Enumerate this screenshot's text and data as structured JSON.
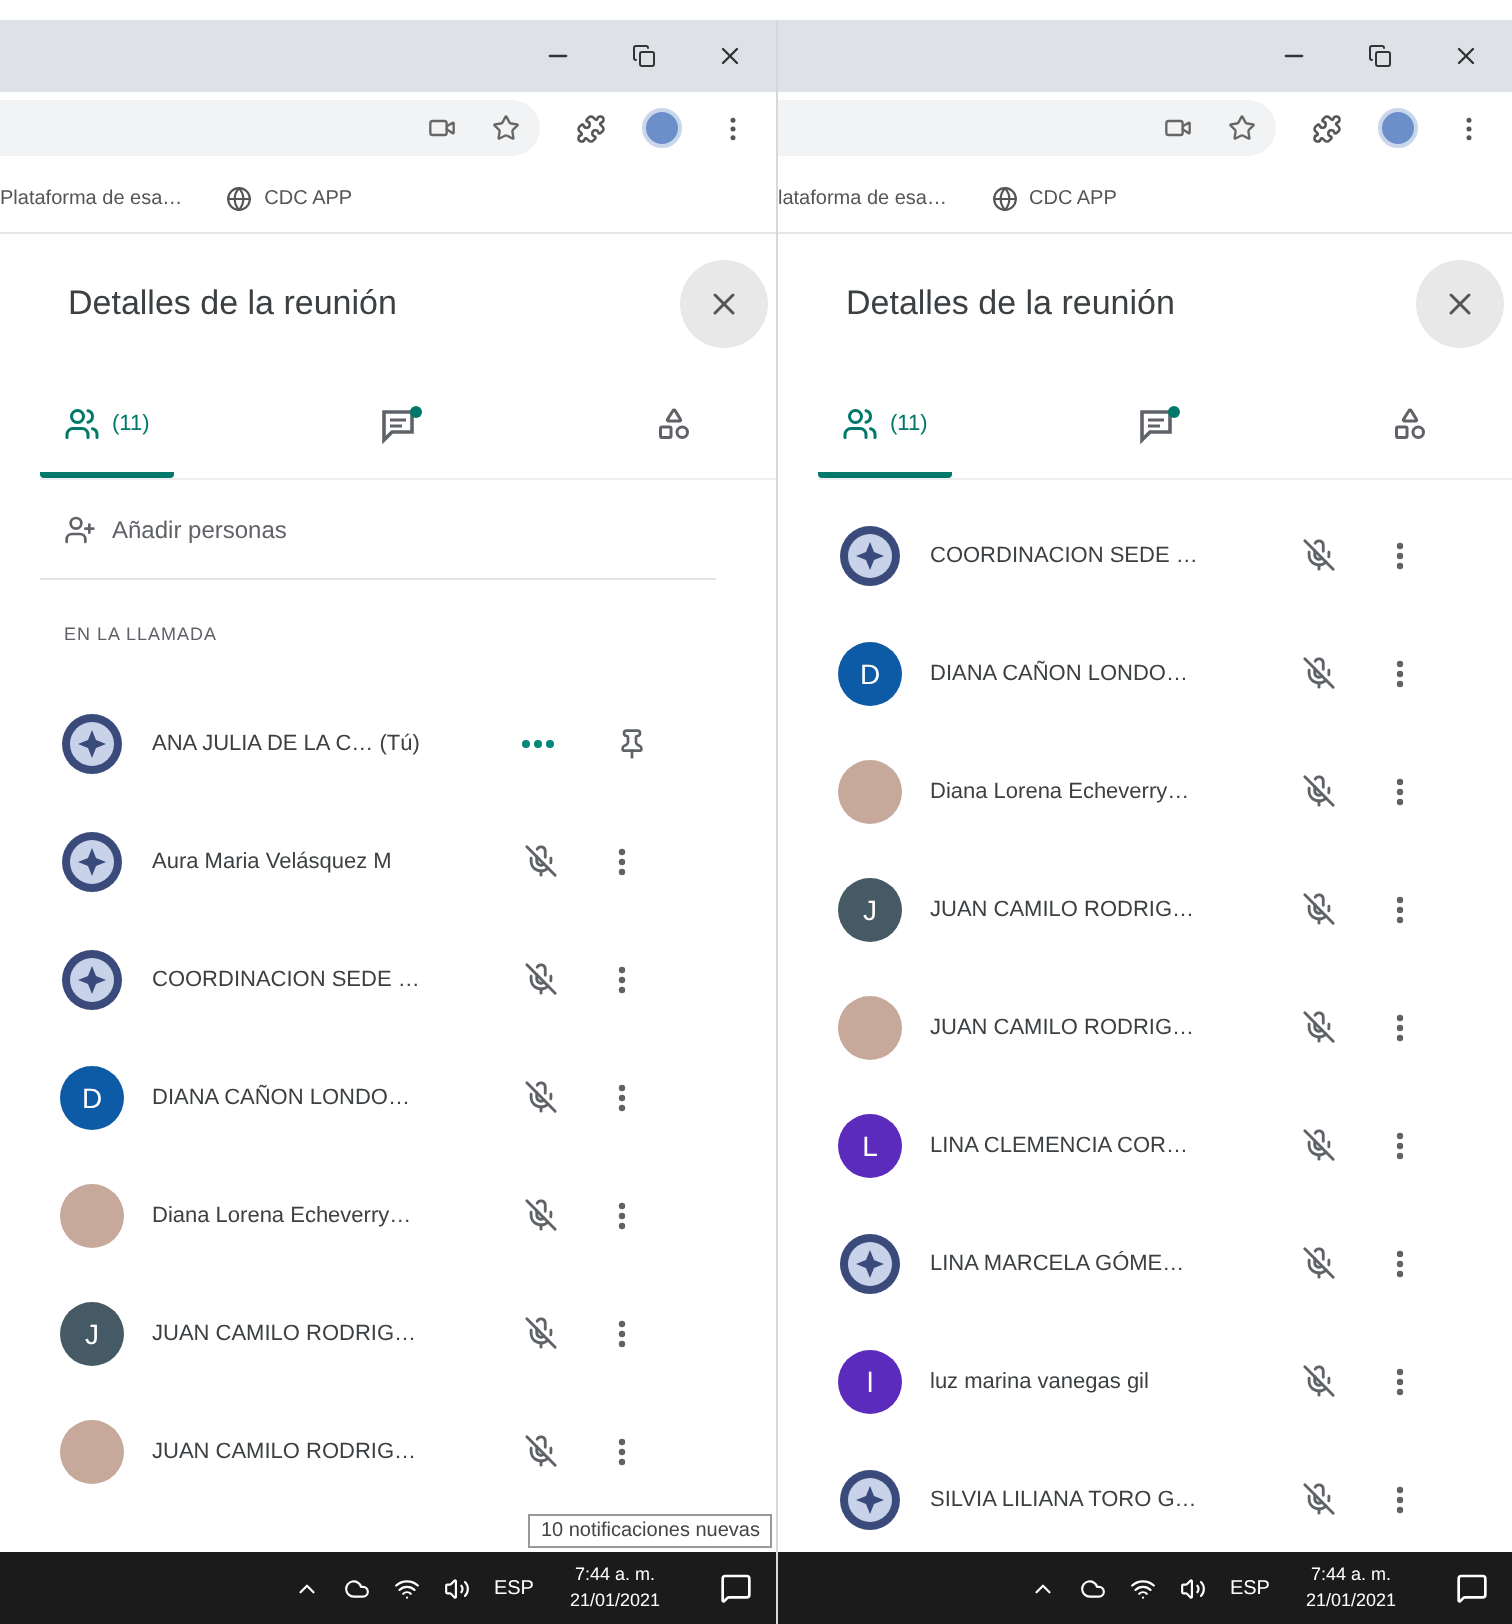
{
  "windows": [
    {
      "bookmarks": [
        {
          "label": "Plataforma de esa…",
          "kind": "plain"
        },
        {
          "label": "CDC APP",
          "kind": "globe"
        }
      ],
      "panel": {
        "title": "Detalles de la reunión",
        "tabs": [
          {
            "kind": "people",
            "label": "(11)",
            "selected": true
          },
          {
            "kind": "chat",
            "selected": false
          },
          {
            "kind": "activities",
            "selected": false
          }
        ],
        "add_people": "Añadir personas",
        "section_label": "EN LA LLAMADA",
        "participants": [
          {
            "name": "ANA JULIA DE LA C…",
            "suffix": "(Tú)",
            "avatar": {
              "kind": "emblem"
            },
            "kind": "self"
          },
          {
            "name": "Aura Maria Velásquez M",
            "avatar": {
              "kind": "emblem"
            },
            "kind": "muted"
          },
          {
            "name": "COORDINACION SEDE …",
            "avatar": {
              "kind": "emblem"
            },
            "kind": "muted"
          },
          {
            "name": "DIANA CAÑON LONDO…",
            "avatar": {
              "kind": "letter",
              "letter": "D",
              "color": "#0d5aa7"
            },
            "kind": "muted"
          },
          {
            "name": "Diana Lorena Echeverry…",
            "avatar": {
              "kind": "photo"
            },
            "kind": "muted"
          },
          {
            "name": "JUAN CAMILO RODRIG…",
            "avatar": {
              "kind": "letter",
              "letter": "J",
              "color": "#455a64"
            },
            "kind": "muted"
          },
          {
            "name": "JUAN CAMILO RODRIG…",
            "avatar": {
              "kind": "photo"
            },
            "kind": "muted"
          }
        ]
      },
      "notice": "10 notificaciones nuevas",
      "taskbar": {
        "language": "ESP",
        "time": "7:44 a. m.",
        "date": "21/01/2021"
      }
    },
    {
      "bookmarks": [
        {
          "label": "lataforma de esa…",
          "kind": "plain"
        },
        {
          "label": "CDC APP",
          "kind": "globe"
        }
      ],
      "panel": {
        "title": "Detalles de la reunión",
        "tabs": [
          {
            "kind": "people",
            "label": "(11)",
            "selected": true
          },
          {
            "kind": "chat",
            "selected": false
          },
          {
            "kind": "activities",
            "selected": false
          }
        ],
        "participants": [
          {
            "name": "COORDINACION SEDE …",
            "avatar": {
              "kind": "emblem"
            },
            "kind": "muted"
          },
          {
            "name": "DIANA CAÑON LONDO…",
            "avatar": {
              "kind": "letter",
              "letter": "D",
              "color": "#0d5aa7"
            },
            "kind": "muted"
          },
          {
            "name": "Diana Lorena Echeverry…",
            "avatar": {
              "kind": "photo"
            },
            "kind": "muted"
          },
          {
            "name": "JUAN CAMILO RODRIG…",
            "avatar": {
              "kind": "letter",
              "letter": "J",
              "color": "#455a64"
            },
            "kind": "muted"
          },
          {
            "name": "JUAN CAMILO RODRIG…",
            "avatar": {
              "kind": "photo"
            },
            "kind": "muted"
          },
          {
            "name": "LINA CLEMENCIA COR…",
            "avatar": {
              "kind": "letter",
              "letter": "L",
              "color": "#5b2bbd"
            },
            "kind": "muted"
          },
          {
            "name": "LINA MARCELA GÓME…",
            "avatar": {
              "kind": "emblem"
            },
            "kind": "muted"
          },
          {
            "name": "luz marina vanegas gil",
            "avatar": {
              "kind": "letter",
              "letter": "l",
              "color": "#5b2bbd"
            },
            "kind": "muted"
          },
          {
            "name": "SILVIA LILIANA TORO G…",
            "avatar": {
              "kind": "emblem"
            },
            "kind": "muted"
          }
        ]
      },
      "taskbar": {
        "language": "ESP",
        "time": "7:44 a. m.",
        "date": "21/01/2021"
      }
    }
  ]
}
